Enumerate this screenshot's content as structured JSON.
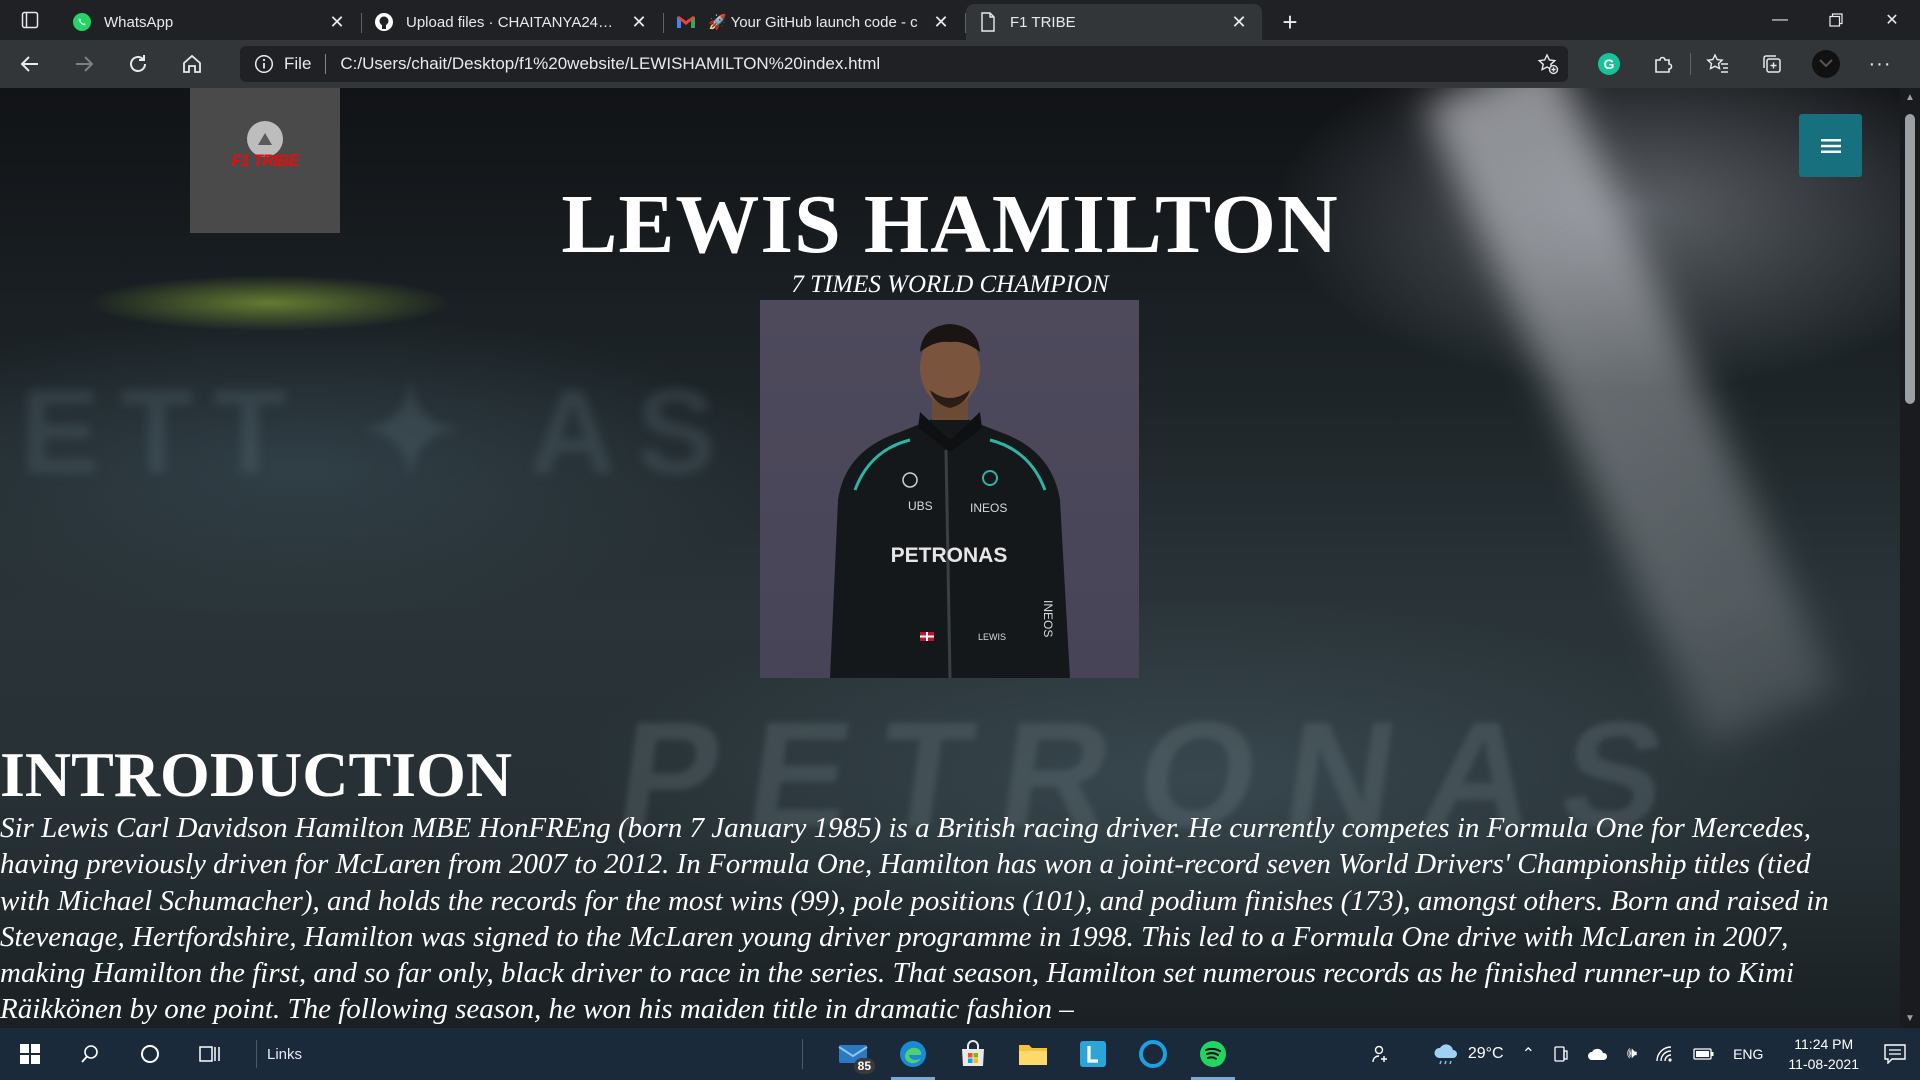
{
  "browser": {
    "tabs": [
      {
        "title": "WhatsApp",
        "icon": "whatsapp-icon"
      },
      {
        "title": "Upload files · CHAITANYA241201",
        "icon": "github-icon"
      },
      {
        "title": "🚀 Your GitHub launch code - c",
        "icon": "gmail-icon"
      },
      {
        "title": "F1 TRIBE",
        "icon": "page-icon",
        "active": true
      }
    ],
    "address": {
      "scheme_label": "File",
      "url": "C:/Users/chait/Desktop/f1%20website/LEWISHAMILTON%20index.html"
    }
  },
  "page": {
    "logo_text": "F1 TRIBE",
    "title": "LEWIS HAMILTON",
    "subtitle": "7 TIMES WORLD CHAMPION",
    "portrait": {
      "suit_sponsors": [
        "UBS",
        "INEOS",
        "PETRONAS",
        "INEOS",
        "LEWIS"
      ]
    },
    "intro": {
      "heading": "INTRODUCTION",
      "text": "Sir Lewis Carl Davidson Hamilton MBE HonFREng (born 7 January 1985) is a British racing driver. He currently competes in Formula One for Mercedes, having previously driven for McLaren from 2007 to 2012. In Formula One, Hamilton has won a joint-record seven World Drivers' Championship titles (tied with Michael Schumacher), and holds the records for the most wins (99), pole positions (101), and podium finishes (173), amongst others. Born and raised in Stevenage, Hertfordshire, Hamilton was signed to the McLaren young driver programme in 1998. This led to a Formula One drive with McLaren in 2007, making Hamilton the first, and so far only, black driver to race in the series. That season, Hamilton set numerous records as he finished runner-up to Kimi Räikkönen by one point. The following season, he won his maiden title in dramatic fashion –"
    },
    "background_text": "PETRONAS"
  },
  "taskbar": {
    "links_label": "Links",
    "mail_badge": "85",
    "weather_temp": "29°C",
    "language": "ENG",
    "time": "11:24 PM",
    "date": "11-08-2021"
  },
  "colors": {
    "menu_button": "#17707e",
    "logo_red": "#e01010",
    "logo_box": "#4a4a4a"
  }
}
